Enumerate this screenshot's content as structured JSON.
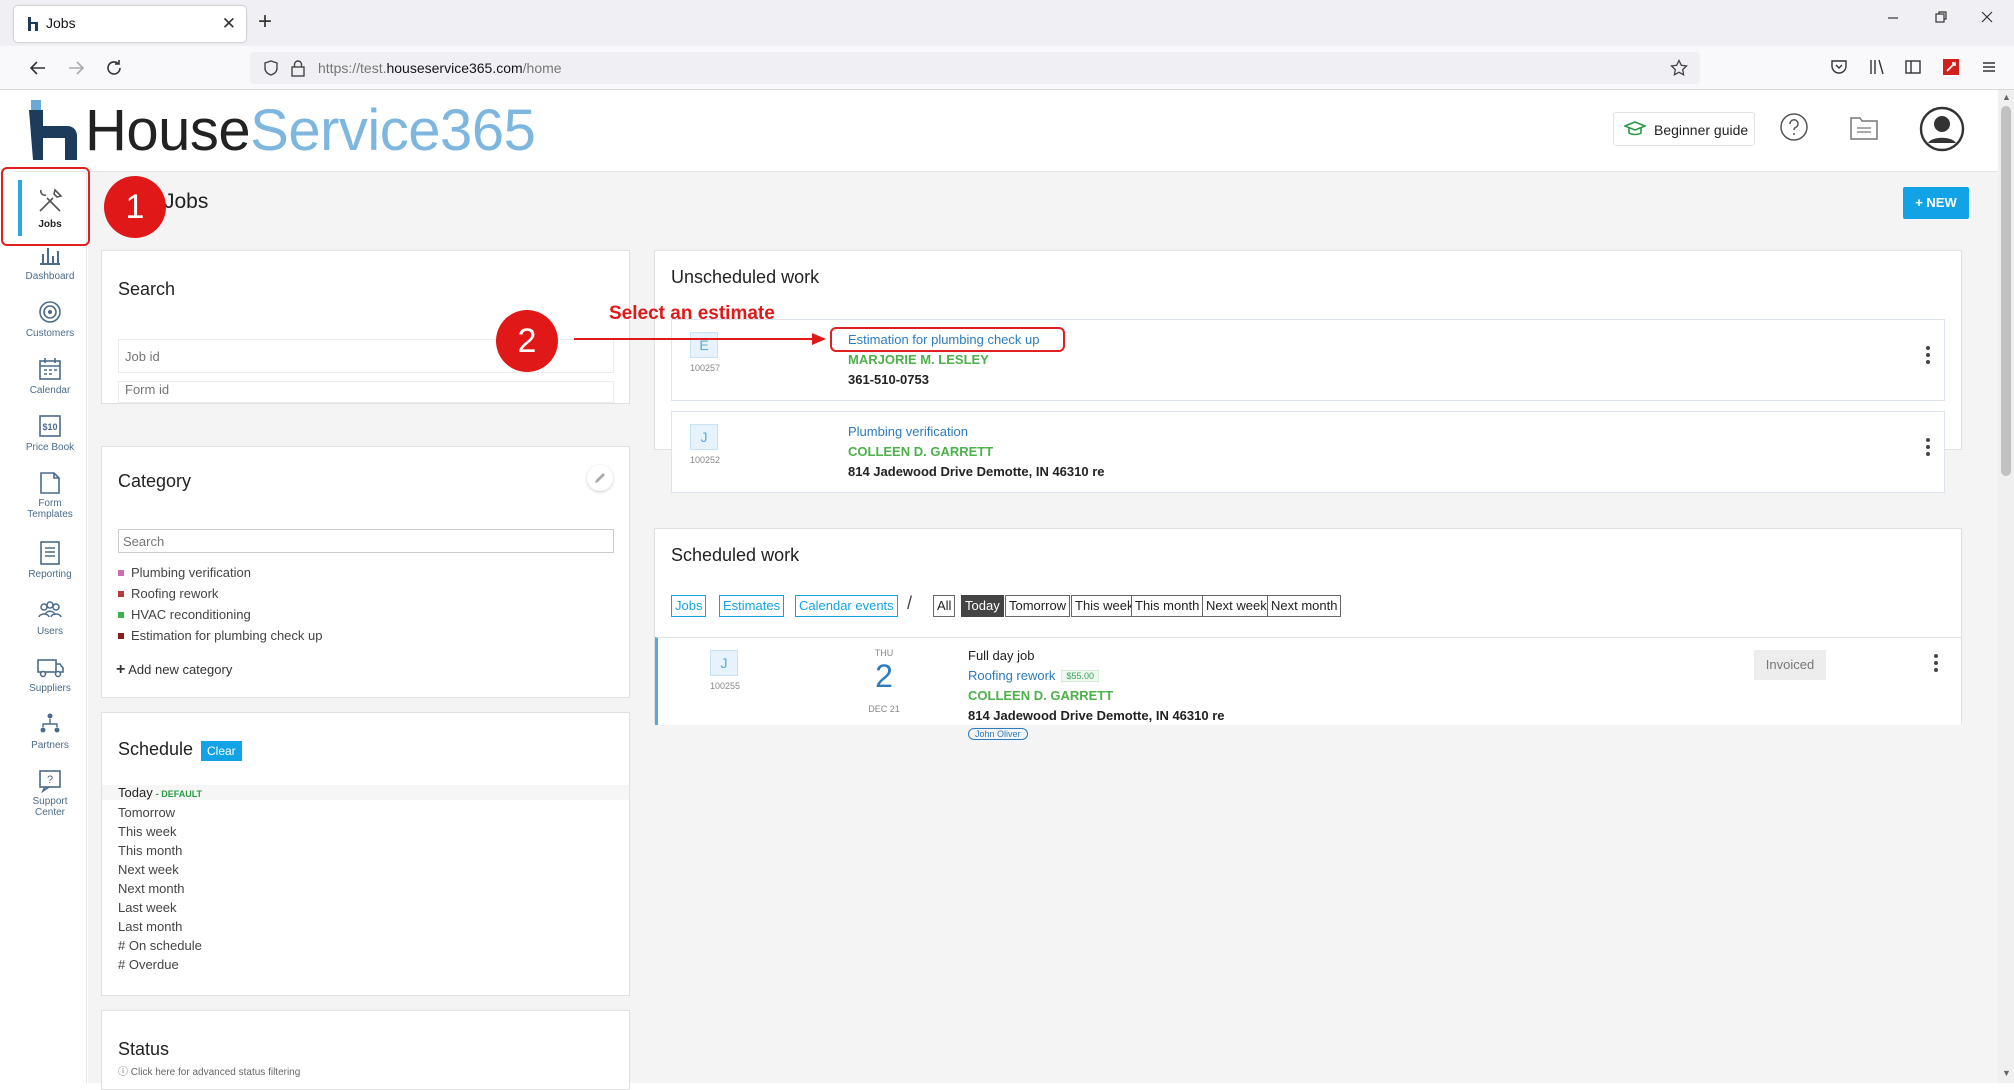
{
  "browser": {
    "tab_title": "Jobs",
    "url_prefix": "https://test.",
    "url_domain": "houseservice365.com",
    "url_path": "/home",
    "new_tab_symbol": "+",
    "close_symbol": "✕"
  },
  "header": {
    "logo_part1": "House",
    "logo_part2": "Service365",
    "beginner_guide": "Beginner guide"
  },
  "sidebar": {
    "items": [
      {
        "label": "Jobs",
        "icon": "tools-icon"
      },
      {
        "label": "Dashboard",
        "icon": "bar-chart-icon"
      },
      {
        "label": "Customers",
        "icon": "target-icon"
      },
      {
        "label": "Calendar",
        "icon": "calendar-icon"
      },
      {
        "label": "Price Book",
        "icon": "price-tag-icon"
      },
      {
        "label": "Form",
        "label2": "Templates",
        "icon": "form-icon"
      },
      {
        "label": "Reporting",
        "icon": "report-icon"
      },
      {
        "label": "Users",
        "icon": "users-icon"
      },
      {
        "label": "Suppliers",
        "icon": "truck-icon"
      },
      {
        "label": "Partners",
        "icon": "network-icon"
      },
      {
        "label": "Support",
        "label2": "Center",
        "icon": "support-icon"
      }
    ]
  },
  "page": {
    "title": "Jobs",
    "new_button": "+ NEW"
  },
  "search": {
    "title": "Search",
    "job_id_placeholder": "Job id",
    "form_id_placeholder": "Form id"
  },
  "category": {
    "title": "Category",
    "search_placeholder": "Search",
    "items": [
      {
        "label": "Plumbing verification",
        "color": "#d16ab0"
      },
      {
        "label": "Roofing rework",
        "color": "#b83a3a"
      },
      {
        "label": "HVAC reconditioning",
        "color": "#3cb34a"
      },
      {
        "label": "Estimation for plumbing check up",
        "color": "#8a1c1c"
      }
    ],
    "add_new": "Add new category"
  },
  "schedule": {
    "title": "Schedule",
    "clear": "Clear",
    "default_tag": "- DEFAULT",
    "options": [
      "Today",
      "Tomorrow",
      "This week",
      "This month",
      "Next week",
      "Next month",
      "Last week",
      "Last month",
      "# On schedule",
      "# Overdue"
    ]
  },
  "status": {
    "title": "Status",
    "hint": "ⓘ Click here for advanced status filtering"
  },
  "unscheduled": {
    "title": "Unscheduled work",
    "items": [
      {
        "badge": "E",
        "id": "100257",
        "title": "Estimation for plumbing check up",
        "customer": "MARJORIE M. LESLEY",
        "detail": "361-510-0753"
      },
      {
        "badge": "J",
        "id": "100252",
        "title": "Plumbing verification",
        "customer": "COLLEEN D. GARRETT",
        "detail": "814 Jadewood Drive Demotte, IN 46310 re"
      }
    ]
  },
  "scheduled": {
    "title": "Scheduled work",
    "type_filters": [
      "Jobs",
      "Estimates",
      "Calendar events"
    ],
    "separator": "/",
    "all_label": "All",
    "time_filters": [
      "Today",
      "Tomorrow",
      "This week",
      "This month",
      "Next week",
      "Next month"
    ],
    "active_filter": "Today",
    "item": {
      "badge": "J",
      "id": "100255",
      "day_name": "THU",
      "day_num": "2",
      "month_day": "DEC 21",
      "kind": "Full day job",
      "title": "Roofing rework",
      "price": "$55.00",
      "customer": "COLLEEN D. GARRETT",
      "address": "814 Jadewood Drive Demotte, IN 46310 re",
      "technician": "John Oliver",
      "status": "Invoiced"
    }
  },
  "annotations": {
    "step1": "1",
    "step2": "2",
    "step2_text": "Select an estimate",
    "color": "#e01818"
  }
}
